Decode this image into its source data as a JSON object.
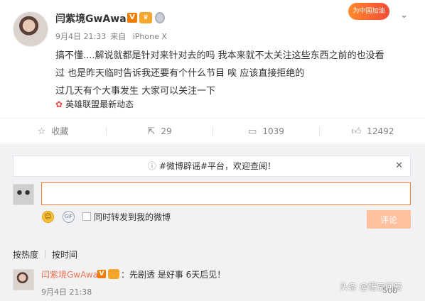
{
  "post": {
    "username": "闫紫境GwAwa",
    "verified_mark": "V",
    "date": "9月4日 21:33",
    "source_prefix": "来自",
    "source": "iPhone X",
    "promo_text": "为中国加油",
    "content_lines": [
      "搞不懂....解说就都是针对来针对去的吗 我本来就不太关注这些东西之前的也没看",
      "过 也是昨天临时告诉我还要有个什么节目 唉 应该直接拒绝的",
      "过几天有个大事发生 大家可以关注一下"
    ],
    "topic": "英雄联盟最新动态"
  },
  "actions": {
    "favorite_label": "收藏",
    "repost_count": "29",
    "comment_count": "1039",
    "like_count": "12492"
  },
  "comment_box": {
    "notice_text": "#微博辟谣#平台，欢迎查阅！",
    "input_value": "",
    "repost_label": "同时转发到我的微博",
    "submit_label": "评论"
  },
  "sort": {
    "hot_label": "按热度",
    "time_label": "按时间"
  },
  "comments": [
    {
      "user": "闫紫境GwAwa",
      "text": "：先剧透 是好事 6天后见！",
      "time": "9月4日 21:38",
      "likes": "508"
    }
  ],
  "watermark": "头条 @悟空问答",
  "colors": {
    "accent": "#fa7d3c",
    "link": "#eb7350",
    "background_panel": "#f2f2f5"
  }
}
